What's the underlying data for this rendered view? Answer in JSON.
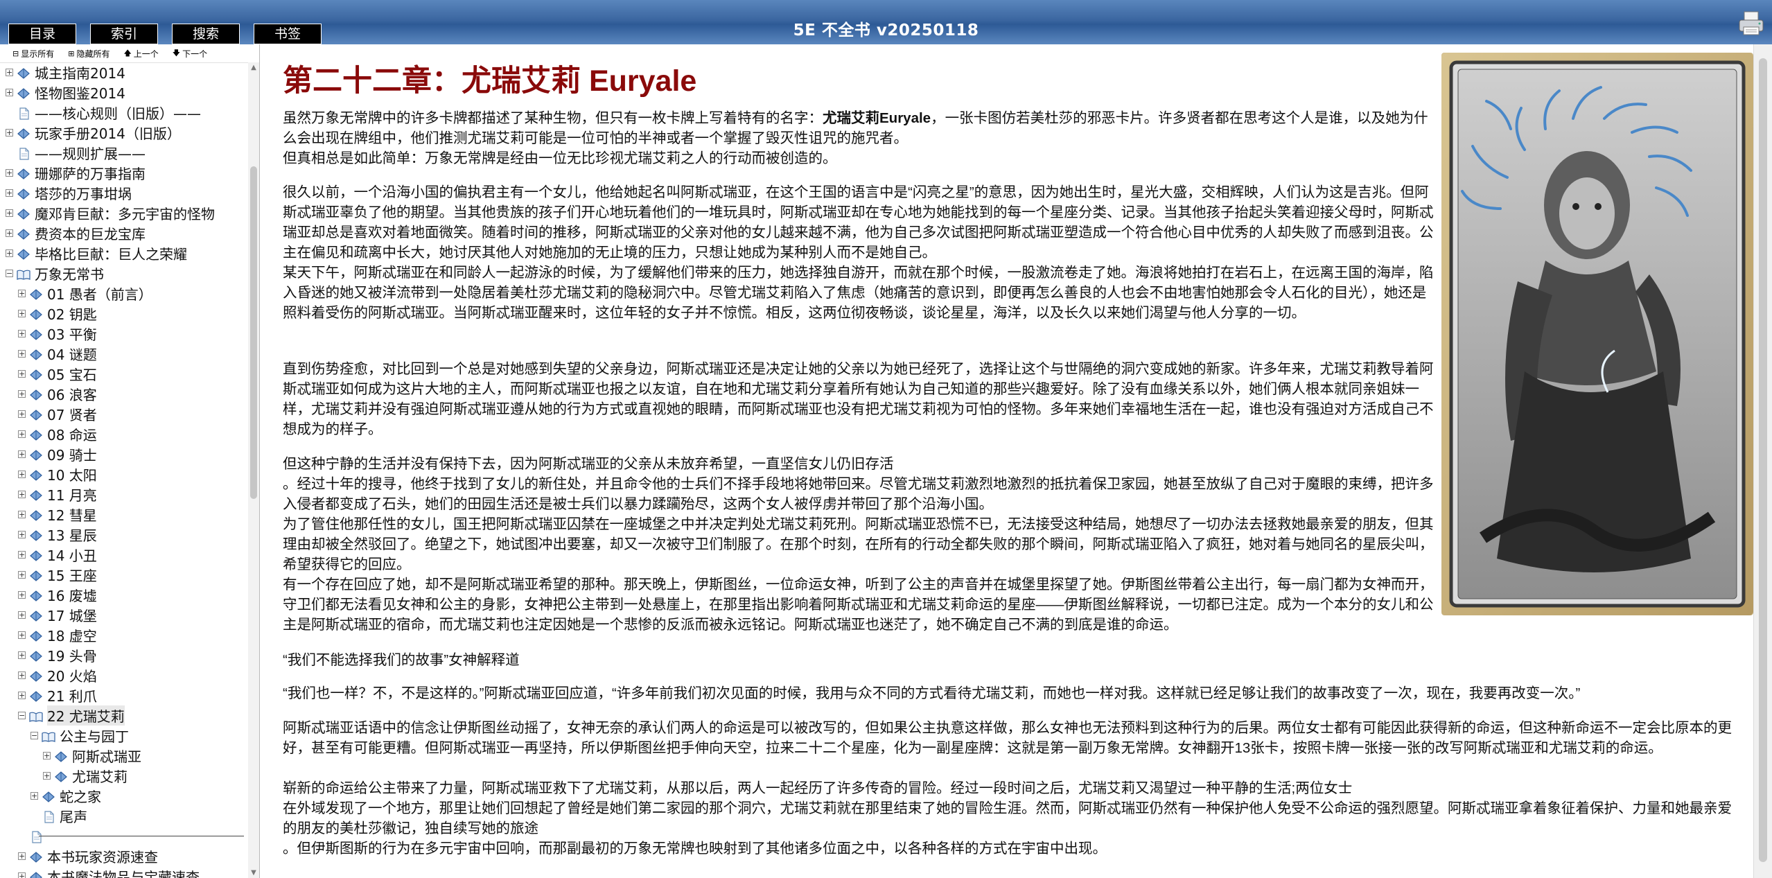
{
  "app": {
    "title": "5E 不全书 v20250118"
  },
  "tabs": [
    "目录",
    "索引",
    "搜索",
    "书签"
  ],
  "sidebar": {
    "controls": {
      "show_all": "显示所有",
      "hide_all": "隐藏所有",
      "prev": "上一个",
      "next": "下一个"
    },
    "tree": [
      {
        "label": "城主指南2014",
        "level": 0,
        "type": "book",
        "expander": "+"
      },
      {
        "label": "怪物图鉴2014",
        "level": 0,
        "type": "book",
        "expander": "+"
      },
      {
        "label": "——核心规则（旧版）——",
        "level": 0,
        "type": "doc",
        "expander": ""
      },
      {
        "label": "玩家手册2014（旧版）",
        "level": 0,
        "type": "book",
        "expander": "+"
      },
      {
        "label": "——规则扩展——",
        "level": 0,
        "type": "doc",
        "expander": ""
      },
      {
        "label": "珊娜萨的万事指南",
        "level": 0,
        "type": "book",
        "expander": "+"
      },
      {
        "label": "塔莎的万事坩埚",
        "level": 0,
        "type": "book",
        "expander": "+"
      },
      {
        "label": "魔邓肯巨献：多元宇宙的怪物",
        "level": 0,
        "type": "book",
        "expander": "+"
      },
      {
        "label": "费资本的巨龙宝库",
        "level": 0,
        "type": "book",
        "expander": "+"
      },
      {
        "label": "毕格比巨献：巨人之荣耀",
        "level": 0,
        "type": "book",
        "expander": "+"
      },
      {
        "label": "万象无常书",
        "level": 0,
        "type": "openbook",
        "expander": "−"
      },
      {
        "label": "01 愚者（前言）",
        "level": 1,
        "type": "book",
        "expander": "+"
      },
      {
        "label": "02 钥匙",
        "level": 1,
        "type": "book",
        "expander": "+"
      },
      {
        "label": "03 平衡",
        "level": 1,
        "type": "book",
        "expander": "+"
      },
      {
        "label": "04 谜题",
        "level": 1,
        "type": "book",
        "expander": "+"
      },
      {
        "label": "05 宝石",
        "level": 1,
        "type": "book",
        "expander": "+"
      },
      {
        "label": "06 浪客",
        "level": 1,
        "type": "book",
        "expander": "+"
      },
      {
        "label": "07 贤者",
        "level": 1,
        "type": "book",
        "expander": "+"
      },
      {
        "label": "08 命运",
        "level": 1,
        "type": "book",
        "expander": "+"
      },
      {
        "label": "09 骑士",
        "level": 1,
        "type": "book",
        "expander": "+"
      },
      {
        "label": "10 太阳",
        "level": 1,
        "type": "book",
        "expander": "+"
      },
      {
        "label": "11 月亮",
        "level": 1,
        "type": "book",
        "expander": "+"
      },
      {
        "label": "12 彗星",
        "level": 1,
        "type": "book",
        "expander": "+"
      },
      {
        "label": "13 星辰",
        "level": 1,
        "type": "book",
        "expander": "+"
      },
      {
        "label": "14 小丑",
        "level": 1,
        "type": "book",
        "expander": "+"
      },
      {
        "label": "15 王座",
        "level": 1,
        "type": "book",
        "expander": "+"
      },
      {
        "label": "16 废墟",
        "level": 1,
        "type": "book",
        "expander": "+"
      },
      {
        "label": "17 城堡",
        "level": 1,
        "type": "book",
        "expander": "+"
      },
      {
        "label": "18 虚空",
        "level": 1,
        "type": "book",
        "expander": "+"
      },
      {
        "label": "19 头骨",
        "level": 1,
        "type": "book",
        "expander": "+"
      },
      {
        "label": "20 火焰",
        "level": 1,
        "type": "book",
        "expander": "+"
      },
      {
        "label": "21 利爪",
        "level": 1,
        "type": "book",
        "expander": "+"
      },
      {
        "label": "22 尤瑞艾莉",
        "level": 1,
        "type": "openbook",
        "expander": "−",
        "selected": true
      },
      {
        "label": "公主与园丁",
        "level": 2,
        "type": "openbook",
        "expander": "−"
      },
      {
        "label": "阿斯忒瑞亚",
        "level": 3,
        "type": "book",
        "expander": "+"
      },
      {
        "label": "尤瑞艾莉",
        "level": 3,
        "type": "book",
        "expander": "+"
      },
      {
        "label": "蛇之家",
        "level": 2,
        "type": "book",
        "expander": "+"
      },
      {
        "label": "尾声",
        "level": 2,
        "type": "doc",
        "expander": ""
      },
      {
        "label": "",
        "level": 1,
        "type": "rule",
        "expander": ""
      },
      {
        "label": "本书玩家资源速查",
        "level": 1,
        "type": "book",
        "expander": "+"
      },
      {
        "label": "本书魔法物品与宝藏速查",
        "level": 1,
        "type": "book",
        "expander": "+"
      }
    ]
  },
  "content": {
    "chapter_title": "第二十二章：尤瑞艾莉 Euryale",
    "p1_before": "虽然万象无常牌中的许多卡牌都描述了某种生物，但只有一枚卡牌上写着特有的名字：",
    "p1_bold": "尤瑞艾莉Euryale",
    "p1_after": "，一张卡图仿若美杜莎的邪恶卡片。许多贤者都在思考这个人是谁，以及她为什么会出现在牌组中，他们推测尤瑞艾莉可能是一位可怕的半神或者一个掌握了毁灭性诅咒的施咒者。",
    "p2": "但真相总是如此简单：万象无常牌是经由一位无比珍视尤瑞艾莉之人的行动而被创造的。",
    "p3": "很久以前，一个沿海小国的偏执君主有一个女儿，他给她起名叫阿斯忒瑞亚，在这个王国的语言中是“闪亮之星”的意思，因为她出生时，星光大盛，交相辉映，人们认为这是吉兆。但阿斯忒瑞亚辜负了他的期望。当其他贵族的孩子们开心地玩着他们的一堆玩具时，阿斯忒瑞亚却在专心地为她能找到的每一个星座分类、记录。当其他孩子抬起头笑着迎接父母时，阿斯忒瑞亚却总是喜欢对着地面微笑。随着时间的推移，阿斯忒瑞亚的父亲对他的女儿越来越不满，他为自己多次试图把阿斯忒瑞亚塑造成一个符合他心目中优秀的人却失败了而感到沮丧。公主在偏见和疏离中长大，她讨厌其他人对她施加的无止境的压力，只想让她成为某种别人而不是她自己。",
    "p4": "某天下午，阿斯忒瑞亚在和同龄人一起游泳的时候，为了缓解他们带来的压力，她选择独自游开，而就在那个时候，一股激流卷走了她。海浪将她拍打在岩石上，在远离王国的海岸，陷入昏迷的她又被洋流带到一处隐居着美杜莎尤瑞艾莉的隐秘洞穴中。尽管尤瑞艾莉陷入了焦虑（她痛苦的意识到，即便再怎么善良的人也会不由地害怕她那会令人石化的目光），她还是照料着受伤的阿斯忒瑞亚。当阿斯忒瑞亚醒来时，这位年轻的女子并不惊慌。相反，这两位彻夜畅谈，谈论星星，海洋，以及长久以来她们渴望与他人分享的一切。",
    "p5": "直到伤势痊愈，对比回到一个总是对她感到失望的父亲身边，阿斯忒瑞亚还是决定让她的父亲以为她已经死了，选择让这个与世隔绝的洞穴变成她的新家。许多年来，尤瑞艾莉教导着阿斯忒瑞亚如何成为这片大地的主人，而阿斯忒瑞亚也报之以友谊，自在地和尤瑞艾莉分享着所有她认为自己知道的那些兴趣爱好。除了没有血缘关系以外，她们俩人根本就同亲姐妹一样，尤瑞艾莉并没有强迫阿斯忒瑞亚遵从她的行为方式或直视她的眼睛，而阿斯忒瑞亚也没有把尤瑞艾莉视为可怕的怪物。多年来她们幸福地生活在一起，谁也没有强迫对方活成自己不想成为的样子。",
    "p6": "但这种宁静的生活并没有保持下去，因为阿斯忒瑞亚的父亲从未放弃希望，一直坚信女儿仍旧存活",
    "p7": "。经过十年的搜寻，他终于找到了女儿的新住处，并且命令他的士兵们不择手段地将她带回来。尽管尤瑞艾莉激烈地激烈的抵抗着保卫家园，她甚至放纵了自己对于魔眼的束缚，把许多入侵者都变成了石头，她们的田园生活还是被士兵们以暴力蹂躏殆尽，这两个女人被俘虏并带回了那个沿海小国。",
    "p8": "为了管住他那任性的女儿，国王把阿斯忒瑞亚囚禁在一座城堡之中并决定判处尤瑞艾莉死刑。阿斯忒瑞亚恐慌不已，无法接受这种结局，她想尽了一切办法去拯救她最亲爱的朋友，但其理由却被全然驳回了。绝望之下，她试图冲出要塞，却又一次被守卫们制服了。在那个时刻，在所有的行动全都失败的那个瞬间，阿斯忒瑞亚陷入了疯狂，她对着与她同名的星辰尖叫，希望获得它的回应。",
    "p9": "有一个存在回应了她，却不是阿斯忒瑞亚希望的那种。那天晚上，伊斯图丝，一位命运女神，听到了公主的声音并在城堡里探望了她。伊斯图丝带着公主出行，每一扇门都为女神而开，守卫们都无法看见女神和公主的身影，女神把公主带到一处悬崖上，在那里指出影响着阿斯忒瑞亚和尤瑞艾莉命运的星座——伊斯图丝解释说，一切都已注定。成为一个本分的女儿和公主是阿斯忒瑞亚的宿命，而尤瑞艾莉也注定因她是一个悲惨的反派而被永远铭记。阿斯忒瑞亚也迷茫了，她不确定自己不满的到底是谁的命运。",
    "p10": "“我们不能选择我们的故事”女神解释道",
    "p11": "“我们也一样？不，不是这样的。”阿斯忒瑞亚回应道，“许多年前我们初次见面的时候，我用与众不同的方式看待尤瑞艾莉，而她也一样对我。这样就已经足够让我们的故事改变了一次，现在，我要再改变一次。”",
    "p12": "阿斯忒瑞亚话语中的信念让伊斯图丝动摇了，女神无奈的承认们两人的命运是可以被改写的，但如果公主执意这样做，那么女神也无法预料到这种行为的后果。两位女士都有可能因此获得新的命运，但这种新命运不一定会比原本的更好，甚至有可能更糟。但阿斯忒瑞亚一再坚持，所以伊斯图丝把手伸向天空，拉来二十二个星座，化为一副星座牌：这就是第一副万象无常牌。女神翻开13张卡，按照卡牌一张接一张的改写阿斯忒瑞亚和尤瑞艾莉的命运。",
    "p13": "崭新的命运给公主带来了力量，阿斯忒瑞亚救下了尤瑞艾莉，从那以后，两人一起经历了许多传奇的冒险。经过一段时间之后，尤瑞艾莉又渴望过一种平静的生活;两位女士",
    "p14": "在外域发现了一个地方，那里让她们回想起了曾经是她们第二家园的那个洞穴，尤瑞艾莉就在那里结束了她的冒险生涯。然而，阿斯忒瑞亚仍然有一种保护他人免受不公命运的强烈愿望。阿斯忒瑞亚拿着象征着保护、力量和她最亲爱的朋友的美杜莎徽记，独自续写她的旅途",
    "p15": "。但伊斯图斯的行为在多元宇宙中回响，而那副最初的万象无常牌也映射到了其他诸多位面之中，以各种各样的方式在宇宙中出现。"
  },
  "icons": {
    "print": "printer-icon",
    "book": "book-icon",
    "open_book": "open-book-icon",
    "document": "document-icon"
  },
  "colors": {
    "header_blue": "#3b66a0",
    "title_red": "#8a0a0a",
    "tab_black": "#000000"
  }
}
